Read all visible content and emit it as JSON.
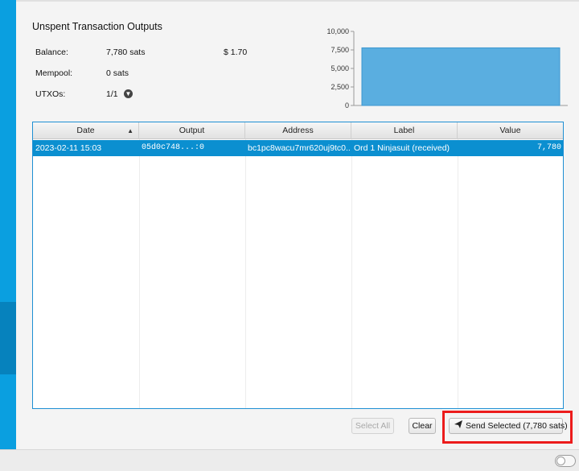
{
  "header": {
    "title": "Unspent Transaction Outputs"
  },
  "summary": {
    "balance_label": "Balance:",
    "balance_value": "7,780 sats",
    "balance_fiat": "$ 1.70",
    "mempool_label": "Mempool:",
    "mempool_value": "0 sats",
    "utxos_label": "UTXOs:",
    "utxos_value": "1/1"
  },
  "chart_data": {
    "type": "bar",
    "categories": [
      ""
    ],
    "values": [
      7780
    ],
    "ylim": [
      0,
      10000
    ],
    "yticks": [
      "10,000",
      "7,500",
      "5,000",
      "2,500",
      "0"
    ],
    "title": "",
    "xlabel": "",
    "ylabel": "",
    "colors": {
      "bar": "#5aaee0",
      "bar_border": "#3c97cf"
    }
  },
  "table": {
    "columns": [
      "Date",
      "Output",
      "Address",
      "Label",
      "Value"
    ],
    "sort_indicator": "▲",
    "rows": [
      {
        "date": "2023-02-11 15:03",
        "output": "05d0c748...:0",
        "address": "bc1pc8wacu7mr620uj9tc0...",
        "label": "Ord 1 Ninjasuit (received)",
        "value": "7,780"
      }
    ]
  },
  "actions": {
    "select_all": "Select All",
    "clear": "Clear",
    "send_selected": "Send Selected (7,780 sats)"
  },
  "colors": {
    "accent": "#0a9fe0",
    "selection": "#0b8fd0",
    "highlight": "#ec1c1c"
  },
  "icons": {
    "utxo_toggle": "chevron-down-circle-icon",
    "send": "paper-plane-icon"
  }
}
